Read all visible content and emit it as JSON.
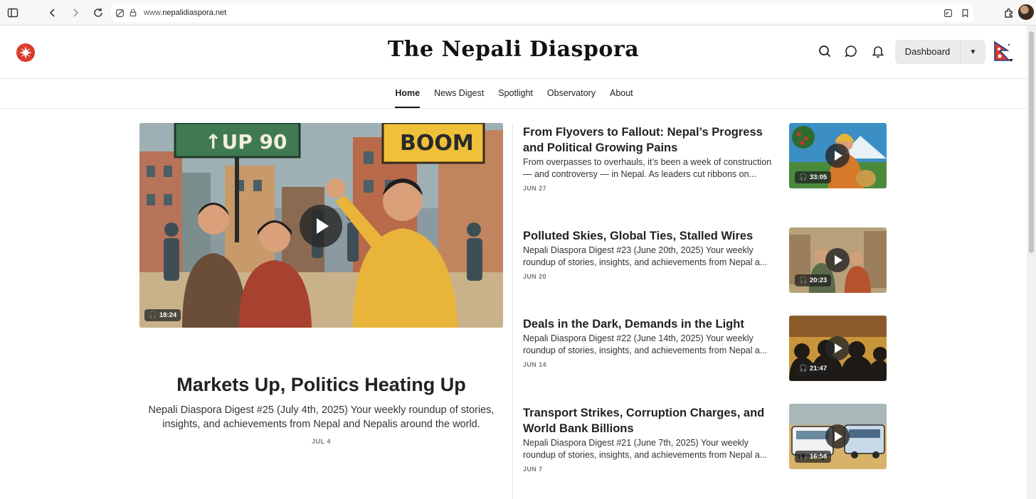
{
  "browser": {
    "url_prefix": "www.",
    "url_domain": "nepalidiaspora.net"
  },
  "site": {
    "title": "The Nepali Diaspora",
    "dashboard_label": "Dashboard",
    "brand_color": "#d93b2b"
  },
  "nav": {
    "items": [
      "Home",
      "News Digest",
      "Spotlight",
      "Observatory",
      "About"
    ],
    "active": "Home"
  },
  "featured": {
    "title": "Markets Up, Politics Heating Up",
    "subtitle": "Nepali Diaspora Digest #25 (July 4th, 2025) Your weekly roundup of stories, insights, and achievements from Nepal and Nepalis around the world.",
    "date": "JUL 4",
    "duration": "18:24",
    "image_signs": [
      "↑UP 90",
      "BOOM"
    ]
  },
  "posts": [
    {
      "title": "From Flyovers to Fallout: Nepal’s Progress and Political Growing Pains",
      "desc": "From overpasses to overhauls, it’s been a week of construction — and controversy — in Nepal. As leaders cut ribbons on...",
      "date": "JUN 27",
      "duration": "33:05"
    },
    {
      "title": "Polluted Skies, Global Ties, Stalled Wires",
      "desc": "Nepali Diaspora Digest #23 (June 20th, 2025) Your weekly roundup of stories, insights, and achievements from Nepal a...",
      "date": "JUN 20",
      "duration": "20:23"
    },
    {
      "title": "Deals in the Dark, Demands in the Light",
      "desc": "Nepali Diaspora Digest #22 (June 14th, 2025) Your weekly roundup of stories, insights, and achievements from Nepal a...",
      "date": "JUN 14",
      "duration": "21:47"
    },
    {
      "title": "Transport Strikes, Corruption Charges, and World Bank Billions",
      "desc": "Nepali Diaspora Digest #21 (June 7th, 2025) Your weekly roundup of stories, insights, and achievements from Nepal a...",
      "date": "JUN 7",
      "duration": "16:58"
    }
  ]
}
